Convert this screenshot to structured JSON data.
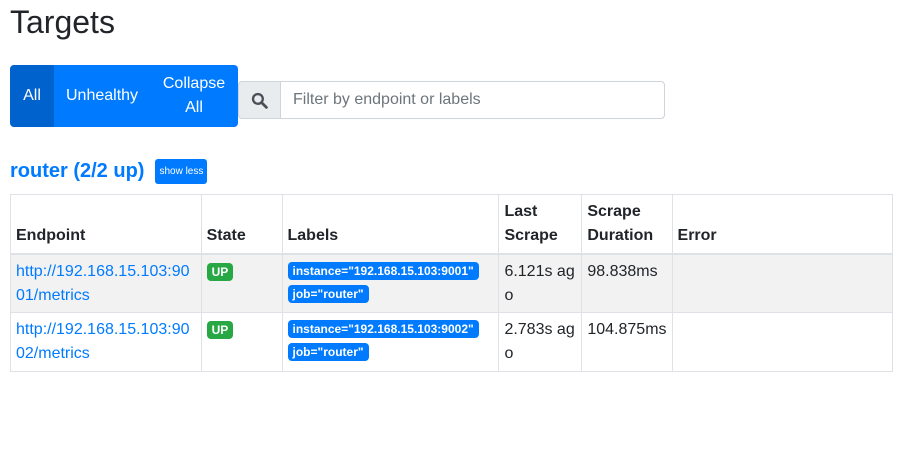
{
  "page": {
    "title": "Targets"
  },
  "toolbar": {
    "all_label": "All",
    "unhealthy_label": "Unhealthy",
    "collapse_label": "Collapse All",
    "filter_placeholder": "Filter by endpoint or labels",
    "filter_icon": "search-icon"
  },
  "job": {
    "title": "router (2/2 up)",
    "toggle_label": "show less"
  },
  "table": {
    "headers": {
      "endpoint": "Endpoint",
      "state": "State",
      "labels": "Labels",
      "last_scrape": "Last Scrape",
      "scrape_duration": "Scrape Duration",
      "error": "Error"
    },
    "rows": [
      {
        "endpoint": "http://192.168.15.103:9001/metrics",
        "state": "UP",
        "labels": [
          "instance=\"192.168.15.103:9001\"",
          "job=\"router\""
        ],
        "last_scrape": "6.121s ago",
        "scrape_duration": "98.838ms",
        "error": ""
      },
      {
        "endpoint": "http://192.168.15.103:9002/metrics",
        "state": "UP",
        "labels": [
          "instance=\"192.168.15.103:9002\"",
          "job=\"router\""
        ],
        "last_scrape": "2.783s ago",
        "scrape_duration": "104.875ms",
        "error": ""
      }
    ]
  },
  "colors": {
    "primary": "#007bff",
    "primary_active": "#0062cc",
    "success": "#28a745"
  }
}
